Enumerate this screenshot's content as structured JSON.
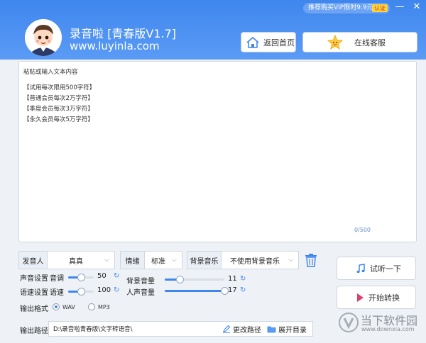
{
  "header": {
    "promo_text": "推荐购买VIP限时9.9元",
    "promo_badge": "认证",
    "app_title": "录音啦 [青春版V1.7]",
    "app_url": "www.luyinla.com",
    "home_button": "返回首页",
    "service_button": "在线客服",
    "minimize": "—",
    "close": "✕"
  },
  "editor": {
    "placeholder": "粘贴或输入文本内容",
    "notes": [
      "【试用每次限用500字符】",
      "【普通会员每次2万字符】",
      "【季度会员每次3万字符】",
      "【永久会员每次5万字符】"
    ],
    "counter": "0/500"
  },
  "controls": {
    "voice_label": "发音人",
    "voice_value": "真真",
    "mood_label": "情绪",
    "mood_value": "标准",
    "music_label": "背景音乐",
    "music_value": "不使用背景音乐",
    "chevron": "⌵"
  },
  "settings": {
    "sound_label": "声音设置",
    "speed_label": "语速设置",
    "pitch_label": "音调",
    "pitch_value": "50",
    "pitch_fraction": 0.5,
    "speed_name": "语速",
    "speed_value": "100",
    "speed_fraction": 0.5,
    "bg_volume_label": "背景音量",
    "bg_volume_value": "11",
    "bg_volume_fraction": 0.25,
    "voice_volume_label": "人声音量",
    "voice_volume_value": "17",
    "voice_volume_fraction": 1.0,
    "reset_glyph": "↻"
  },
  "output": {
    "format_label": "输出格式",
    "formats": [
      "WAV",
      "MP3"
    ],
    "selected_format": "WAV",
    "path_label": "输出路径",
    "path_value": "D:\\录音啦青春版\\文字转语音\\",
    "change_path": "更改路径",
    "open_folder": "展开目录"
  },
  "actions": {
    "listen": "试听一下",
    "convert": "开始转换"
  },
  "watermark": {
    "text": "当下软件园",
    "url": "www.downxia.com"
  }
}
